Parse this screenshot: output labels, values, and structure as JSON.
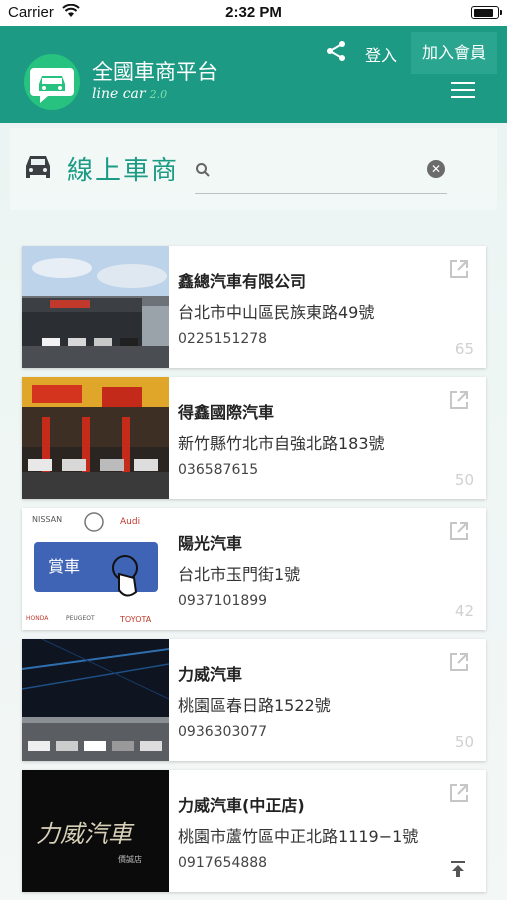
{
  "status_bar": {
    "carrier": "Carrier",
    "time": "2:32 PM"
  },
  "header": {
    "title": "全國車商平台",
    "subtitle": "line car",
    "version": "2.0",
    "login_label": "登入",
    "join_label": "加入會員",
    "brand_color": "#1c9a83"
  },
  "search": {
    "section_title": "線上車商",
    "placeholder": "",
    "value": ""
  },
  "dealers": [
    {
      "name": "鑫總汽車有限公司",
      "address": "台北市中山區民族東路49號",
      "phone": "0225151278",
      "count": "65"
    },
    {
      "name": "得鑫國際汽車",
      "address": "新竹縣竹北市自強北路183號",
      "phone": "036587615",
      "count": "50"
    },
    {
      "name": "陽光汽車",
      "address": "台北市玉門街1號",
      "phone": "0937101899",
      "count": "42"
    },
    {
      "name": "力威汽車",
      "address": "桃園區春日路1522號",
      "phone": "0936303077",
      "count": "50"
    },
    {
      "name": "力威汽車(中正店)",
      "address": "桃園市蘆竹區中正北路1119−1號",
      "phone": "0917654888",
      "count": ""
    }
  ],
  "thumb_text": {
    "sunny_badge": "賞車",
    "brands": [
      "NISSAN",
      "Audi",
      "HONDA",
      "PEUGEOT",
      "TOYOTA"
    ],
    "liwei_logo": "力威汽車",
    "liwei_sub": "價誠店"
  }
}
